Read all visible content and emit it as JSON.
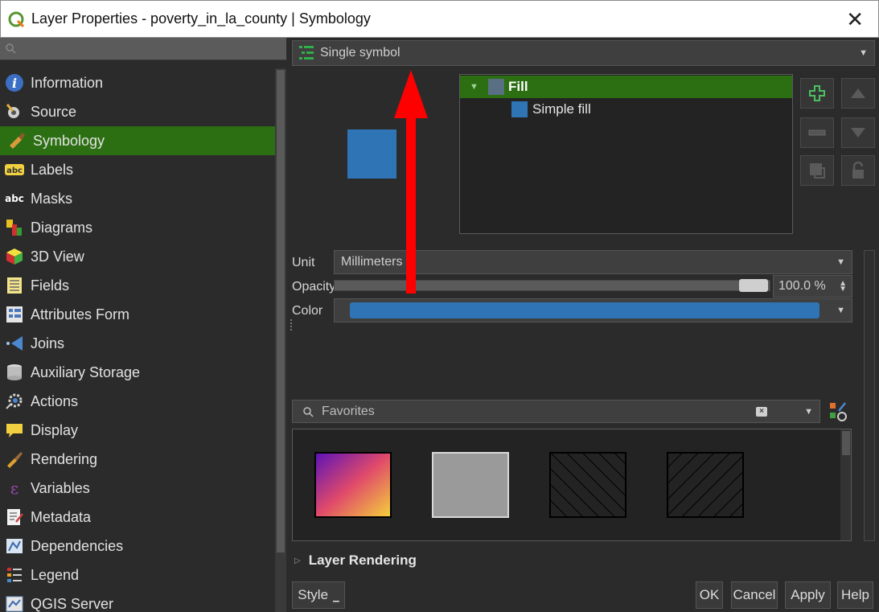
{
  "window": {
    "title": "Layer Properties - poverty_in_la_county | Symbology",
    "app_icon": "qgis-logo-icon",
    "close_icon": "close-icon"
  },
  "sidebar": {
    "search_placeholder": "",
    "items": [
      {
        "label": "Information",
        "icon": "info-icon"
      },
      {
        "label": "Source",
        "icon": "source-icon"
      },
      {
        "label": "Symbology",
        "icon": "symbology-brush-icon",
        "active": true
      },
      {
        "label": "Labels",
        "icon": "labels-abc-icon"
      },
      {
        "label": "Masks",
        "icon": "masks-abc-icon"
      },
      {
        "label": "Diagrams",
        "icon": "diagrams-icon"
      },
      {
        "label": "3D View",
        "icon": "cube-icon"
      },
      {
        "label": "Fields",
        "icon": "fields-icon"
      },
      {
        "label": "Attributes Form",
        "icon": "form-icon"
      },
      {
        "label": "Joins",
        "icon": "joins-icon"
      },
      {
        "label": "Auxiliary Storage",
        "icon": "database-icon"
      },
      {
        "label": "Actions",
        "icon": "actions-gear-icon"
      },
      {
        "label": "Display",
        "icon": "speech-bubble-icon"
      },
      {
        "label": "Rendering",
        "icon": "rendering-brush-icon"
      },
      {
        "label": "Variables",
        "icon": "epsilon-icon"
      },
      {
        "label": "Metadata",
        "icon": "metadata-icon"
      },
      {
        "label": "Dependencies",
        "icon": "dependencies-icon"
      },
      {
        "label": "Legend",
        "icon": "legend-icon"
      },
      {
        "label": "QGIS Server",
        "icon": "server-icon"
      }
    ]
  },
  "renderer": {
    "selected": "Single symbol",
    "icon": "single-symbol-icon"
  },
  "symbol_tree": {
    "rows": [
      {
        "label": "Fill",
        "selected": true,
        "swatch_color": "#5a6f84"
      },
      {
        "label": "Simple fill",
        "selected": false,
        "swatch_color": "#2f75b5"
      }
    ]
  },
  "symbol_buttons": [
    "add-layer-icon",
    "move-up-icon",
    "remove-layer-icon",
    "move-down-icon",
    "duplicate-layer-icon",
    "lock-icon"
  ],
  "properties": {
    "unit_label": "Unit",
    "unit_value": "Millimeters",
    "opacity_label": "Opacity",
    "opacity_value": "100.0 %",
    "opacity_fraction": 1.0,
    "color_label": "Color",
    "color_value": "#2f75b5"
  },
  "favorites": {
    "placeholder": "Favorites",
    "clear_icon": "clear-icon",
    "style_manager_icon": "style-manager-icon",
    "items": [
      {
        "name": "gradient-fill-preview",
        "colors": [
          "#5b12b8",
          "#e04a6a",
          "#f5d13a"
        ]
      },
      {
        "name": "gray-fill-preview",
        "color": "#9a9a9a"
      },
      {
        "name": "hatch-fill-preview",
        "pattern": "diagonal-right"
      },
      {
        "name": "hatch-fill-preview",
        "pattern": "diagonal-left"
      }
    ]
  },
  "layer_rendering": {
    "label": "Layer Rendering"
  },
  "buttons": {
    "style": "Style",
    "ok": "OK",
    "cancel": "Cancel",
    "apply": "Apply",
    "help": "Help"
  },
  "colors": {
    "accent_green": "#2c6f12",
    "annotation_arrow": "#ff0000",
    "fill_blue": "#2f75b5"
  }
}
